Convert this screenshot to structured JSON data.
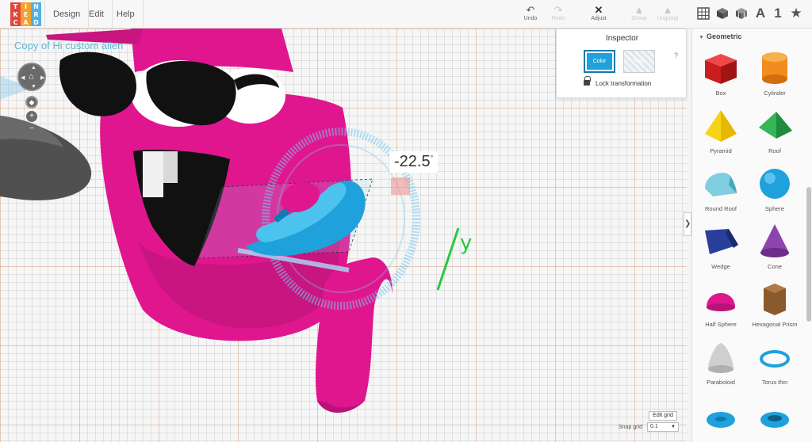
{
  "app": {
    "logo_letters": [
      "T",
      "I",
      "N",
      "K",
      "E",
      "R",
      "C",
      "A",
      "D"
    ],
    "logo_colors": [
      "#e2473b",
      "#f2a22c",
      "#4fb2e0",
      "#e2473b",
      "#f2a22c",
      "#4fb2e0",
      "#e2473b",
      "#f2a22c",
      "#4fb2e0"
    ]
  },
  "menu": {
    "design": "Design",
    "edit": "Edit",
    "help": "Help"
  },
  "toolbar": {
    "undo": "Undo",
    "redo": "Redo",
    "adjust": "Adjust",
    "group": "Group",
    "ungroup": "Ungroup",
    "text_tool": "A",
    "number_tool": "1",
    "star_tool": "★"
  },
  "canvas": {
    "design_title": "Copy of Hi custom alien",
    "angle_value": "-22.5",
    "angle_unit": "°",
    "axis_label": "y",
    "edit_grid": "Edit grid",
    "snap_grid_label": "Snap grid",
    "snap_grid_value": "0.1",
    "snap_grid_caret": "▼"
  },
  "inspector": {
    "title": "Inspector",
    "color_btn": "Color",
    "hole_btn": "Hole",
    "help": "?",
    "lock_label": "Lock transformation",
    "selected_color": "#1fa1db"
  },
  "sidebar": {
    "category": "Geometric",
    "toggle": "❯",
    "shapes": [
      {
        "label": "Box",
        "icon": "box-shape-icon"
      },
      {
        "label": "Cylinder",
        "icon": "cylinder-shape-icon"
      },
      {
        "label": "Pyramid",
        "icon": "pyramid-shape-icon"
      },
      {
        "label": "Roof",
        "icon": "roof-shape-icon"
      },
      {
        "label": "Round Roof",
        "icon": "round-roof-shape-icon"
      },
      {
        "label": "Sphere",
        "icon": "sphere-shape-icon"
      },
      {
        "label": "Wedge",
        "icon": "wedge-shape-icon"
      },
      {
        "label": "Cone",
        "icon": "cone-shape-icon"
      },
      {
        "label": "Half Sphere",
        "icon": "half-sphere-shape-icon"
      },
      {
        "label": "Hexagonal Prism",
        "icon": "hexagonal-prism-shape-icon"
      },
      {
        "label": "Paraboloid",
        "icon": "paraboloid-shape-icon"
      },
      {
        "label": "Torus thin",
        "icon": "torus-thin-shape-icon"
      },
      {
        "label": "",
        "icon": "torus-shape-icon"
      },
      {
        "label": "",
        "icon": "tube-shape-icon"
      }
    ]
  },
  "colors": {
    "object_magenta": "#e0168f",
    "accent_blue": "#1fa1db",
    "axis_green": "#27c93f"
  }
}
